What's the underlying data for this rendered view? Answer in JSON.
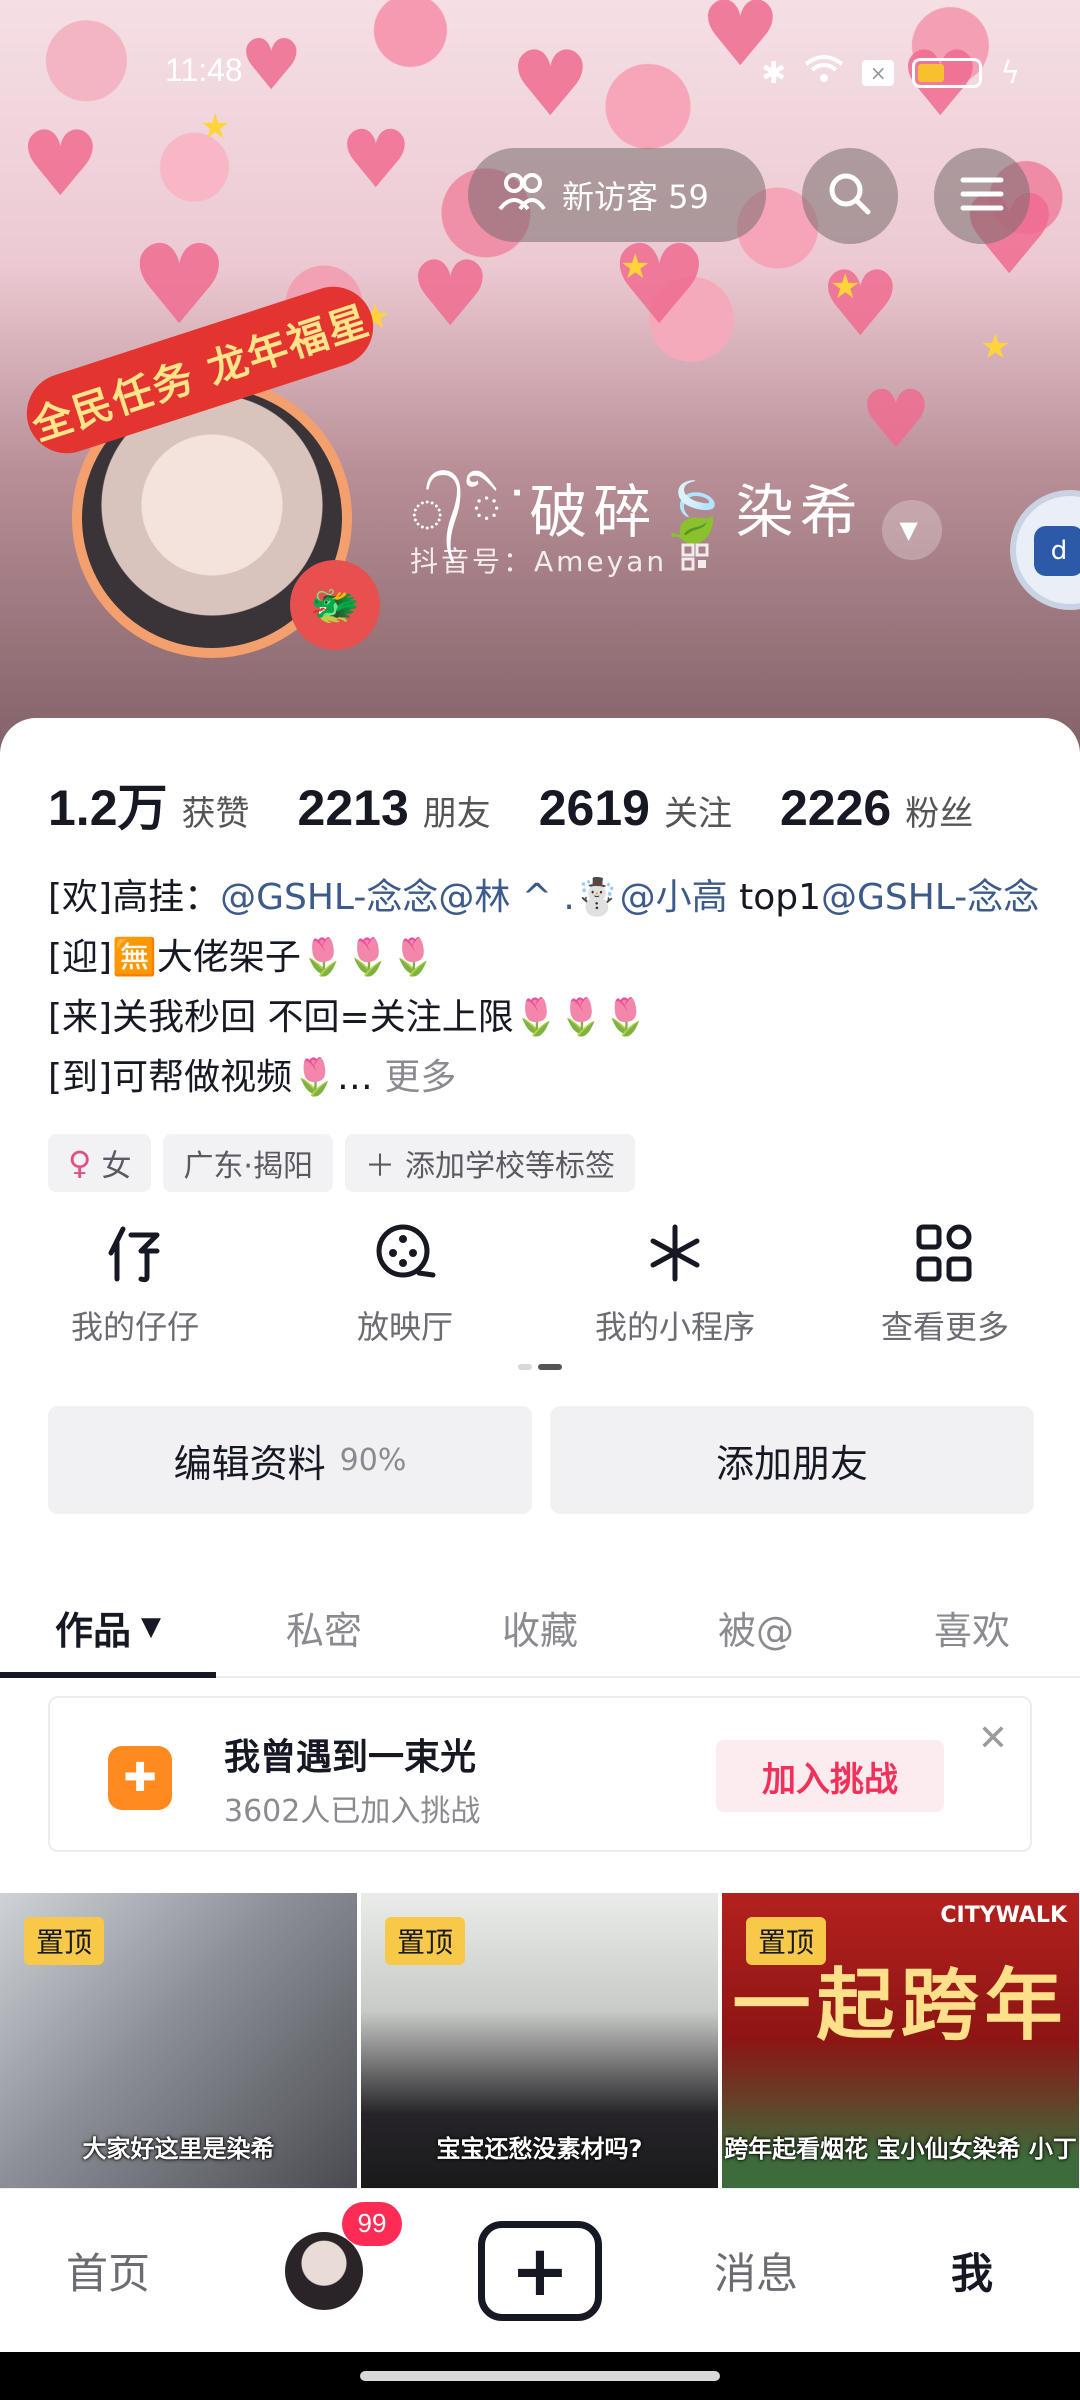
{
  "status_bar": {
    "time": "11:48",
    "icons": [
      "bluetooth-icon",
      "wifi-icon",
      "sim-icon",
      "battery-icon",
      "charging-icon"
    ],
    "battery_color": "#f7c02e"
  },
  "header": {
    "visitor_label": "新访客 59",
    "visitor_icon": "people-icon",
    "search_icon": "search-icon",
    "menu_icon": "menu-icon"
  },
  "profile": {
    "avatar_frame_text": "全民任务 龙年福星",
    "nickname": "᭄ིᐝ破碎🍃染希",
    "douyin_id": "抖音号：Ameyan",
    "qr_icon": "qr-code-icon"
  },
  "stats": [
    {
      "value": "1.2万",
      "label": "获赞"
    },
    {
      "value": "2213",
      "label": "朋友"
    },
    {
      "value": "2619",
      "label": "关注"
    },
    {
      "value": "2226",
      "label": "粉丝"
    }
  ],
  "bio": {
    "line1_prefix": "[欢]高挂：",
    "line1_mentions": "@GSHL-念念@林 ^ .☃️@小高",
    "line1_mid": "  top1",
    "line1_mention2": "@GSHL-念念",
    "line2": "[迎]🈚大佬架子🌷🌷🌷",
    "line3": "[来]关我秒回 不回=关注上限🌷🌷🌷",
    "line4": "[到]可帮做视频🌷…",
    "more": " 更多"
  },
  "tags": [
    {
      "icon": "female-icon",
      "label": "女"
    },
    {
      "label": "广东·揭阳"
    },
    {
      "icon": "plus-icon",
      "label": "添加学校等标签"
    }
  ],
  "shortcuts": [
    {
      "icon": "zaizai-icon",
      "label": "我的仔仔"
    },
    {
      "icon": "film-reel-icon",
      "label": "放映厅"
    },
    {
      "icon": "mini-program-icon",
      "label": "我的小程序"
    },
    {
      "icon": "grid-icon",
      "label": "查看更多"
    }
  ],
  "pager": {
    "active_color": "#555555",
    "inactive_color": "#d8d8d8"
  },
  "actions": {
    "edit_label": "编辑资料",
    "edit_percent": "90%",
    "add_friend_label": "添加朋友"
  },
  "tabs": [
    {
      "label": "作品",
      "active": true
    },
    {
      "label": "私密"
    },
    {
      "label": "收藏"
    },
    {
      "label": "被@"
    },
    {
      "label": "喜欢"
    }
  ],
  "challenge": {
    "title": "我曾遇到一束光",
    "subtitle": "3602人已加入挑战",
    "join_label": "加入挑战",
    "accent_color": "#f2305a"
  },
  "videos": [
    {
      "pin": "置顶",
      "caption": "大家好这里是染希"
    },
    {
      "pin": "置顶",
      "caption": "宝宝还愁没素材吗?"
    },
    {
      "pin": "置顶",
      "title_text": "一起跨年",
      "corner": "CITYWALK",
      "caption": "跨年起看烟花 宝小仙女染希  小丁"
    }
  ],
  "bottom_nav": {
    "home": "首页",
    "friends_badge": "99",
    "create_symbol": "+",
    "messages": "消息",
    "me": "我"
  }
}
